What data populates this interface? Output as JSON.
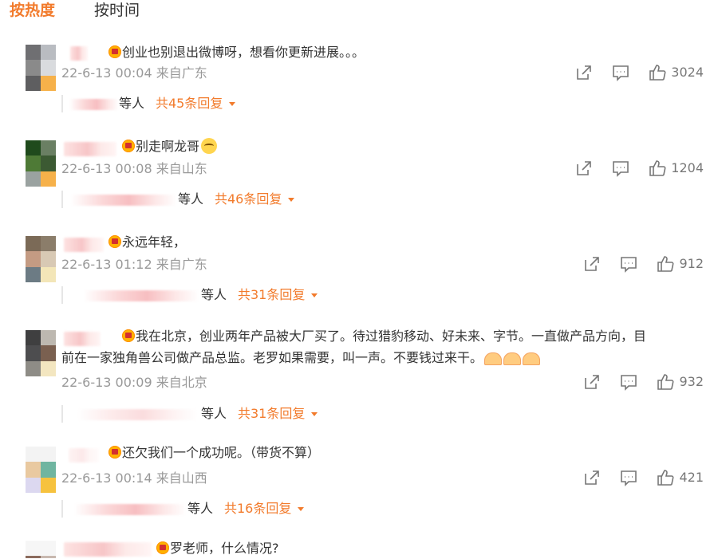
{
  "tabs": {
    "hot": "按热度",
    "time": "按时间"
  },
  "comments": [
    {
      "text": "创业也别退出微博呀，想看你更新进展。。。",
      "date": "22-6-13 00:04",
      "location": "来自广东",
      "likes": "3024",
      "replies_etc": "等人",
      "replies_count": "共45条回复"
    },
    {
      "text": "别走啊龙哥",
      "emoji": "cry-emoji",
      "date": "22-6-13 00:08",
      "location": "来自山东",
      "likes": "1204",
      "replies_etc": "等人",
      "replies_count": "共46条回复"
    },
    {
      "text": "永远年轻，",
      "date": "22-6-13 01:12",
      "location": "来自广东",
      "likes": "912",
      "replies_etc": "等人",
      "replies_count": "共31条回复"
    },
    {
      "text": "我在北京，创业两年产品被大厂买了。待过猎豹移动、好未来、字节。一直做产品方向，目",
      "text2": "前在一家独角兽公司做产品总监。老罗如果需要，叫一声。不要钱过来干。",
      "emoji": "folded-hands-emoji",
      "date": "22-6-13 00:09",
      "location": "来自北京",
      "likes": "932",
      "replies_etc": "等人",
      "replies_count": "共31条回复"
    },
    {
      "text": "还欠我们一个成功呢。（带货不算）",
      "date": "22-6-13 00:14",
      "location": "来自山西",
      "likes": "421",
      "replies_etc": "等人",
      "replies_count": "共16条回复"
    },
    {
      "text": "罗老师，什么情况?"
    }
  ],
  "colors": {
    "accent": "#f27b2c",
    "meta": "#999999",
    "text": "#333333"
  },
  "icons": [
    "share-icon",
    "comment-icon",
    "like-icon",
    "vip-badge-icon",
    "chevron-down-icon"
  ]
}
